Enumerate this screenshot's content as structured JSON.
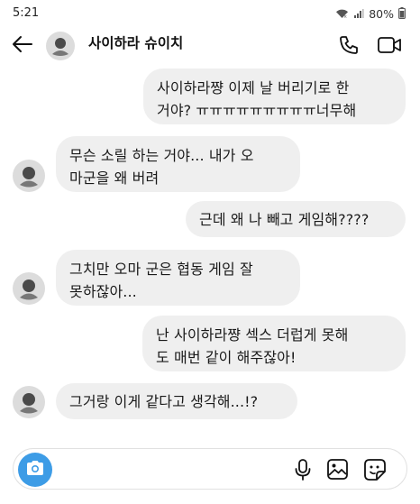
{
  "status_bar": {
    "time": "5:21",
    "battery_percent": "80%"
  },
  "header": {
    "title": "사이하라 슈이치"
  },
  "messages": [
    {
      "sender": "self",
      "lines": [
        "사이하라쨩 이제 날 버리기로 한",
        "거야? ㅠㅠㅠㅠㅠㅠㅠㅠㅠ너무해"
      ]
    },
    {
      "sender": "other",
      "lines": [
        "무슨 소릴 하는 거야... 내가 오",
        "마군을 왜 버려"
      ]
    },
    {
      "sender": "self",
      "lines": [
        "근데 왜 나 빼고 게임해????"
      ]
    },
    {
      "sender": "other",
      "lines": [
        "그치만 오마 군은 협동 게임 잘",
        "못하잖아..."
      ]
    },
    {
      "sender": "self",
      "lines": [
        "난 사이하라쨩 섹스 더럽게 못해",
        "도 매번 같이 해주잖아!"
      ]
    },
    {
      "sender": "other",
      "lines": [
        "그거랑 이게 같다고 생각해...!?"
      ]
    }
  ],
  "colors": {
    "bubble_bg": "#efefef",
    "camera_button": "#3d9ce6",
    "avatar_bg": "#dcdcdc"
  },
  "icons": [
    "back-arrow-icon",
    "phone-icon",
    "video-camera-icon",
    "camera-icon",
    "microphone-icon",
    "gallery-icon",
    "sticker-icon",
    "wifi-icon",
    "signal-icon",
    "battery-icon"
  ]
}
